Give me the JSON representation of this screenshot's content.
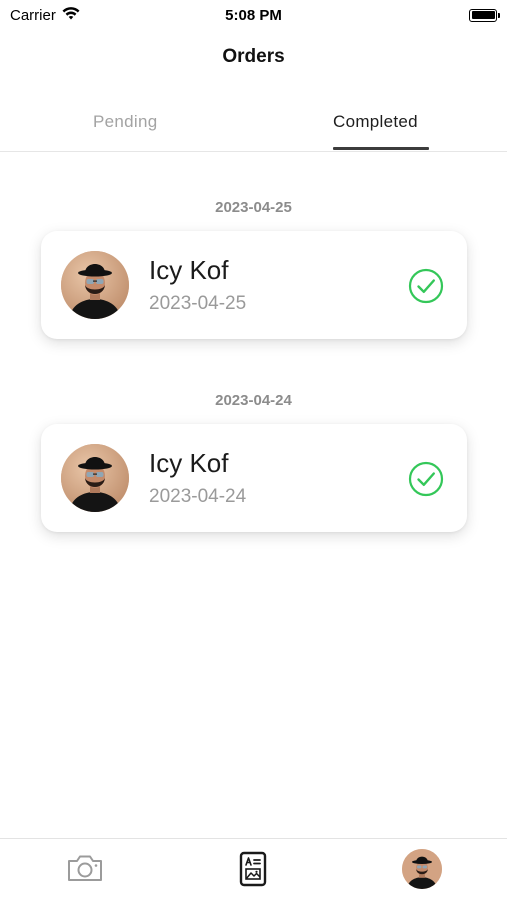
{
  "status_bar": {
    "carrier": "Carrier",
    "time": "5:08 PM"
  },
  "header": {
    "title": "Orders"
  },
  "tabs": [
    {
      "label": "Pending",
      "selected": false
    },
    {
      "label": "Completed",
      "selected": true
    }
  ],
  "sections": [
    {
      "date": "2023-04-25",
      "order": {
        "name": "Icy Kof",
        "date": "2023-04-25",
        "status_icon": "check-circle-icon"
      }
    },
    {
      "date": "2023-04-24",
      "order": {
        "name": "Icy Kof",
        "date": "2023-04-24",
        "status_icon": "check-circle-icon"
      }
    }
  ],
  "tab_bar": {
    "items": [
      {
        "icon": "camera-icon"
      },
      {
        "icon": "orders-document-icon"
      },
      {
        "icon": "profile-avatar"
      }
    ]
  },
  "colors": {
    "success": "#34c759",
    "muted_text": "#9a9a9a",
    "tab_inactive": "#a3a3a3",
    "tab_indicator": "#3c3c3c"
  }
}
